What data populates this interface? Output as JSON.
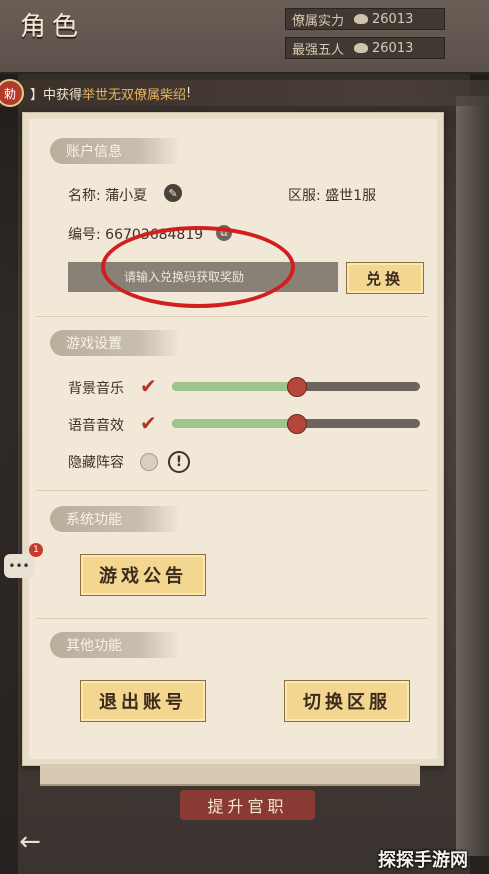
{
  "header": {
    "title": "角色",
    "stats": [
      {
        "label": "僚属实力",
        "icon": "lotus-icon",
        "value": "26013"
      },
      {
        "label": "最强五人",
        "icon": "lotus-icon",
        "value": "26013"
      }
    ]
  },
  "notice": {
    "prefix": "】中获得",
    "highlight": "举世无双僚属柴绍",
    "suffix": "!"
  },
  "account": {
    "section_title": "账户信息",
    "name_label": "名称: 蒲小夏",
    "server_label": "区服: 盛世1服",
    "id_label": "编号: 6670",
    "id_suffix": "3684819",
    "redeem_placeholder": "请输入兑换码获取奖励",
    "redeem_button": "兑换"
  },
  "game_settings": {
    "section_title": "游戏设置",
    "bgm_label": "背景音乐",
    "bgm_checked": true,
    "bgm_level": 0.5,
    "sfx_label": "语音音效",
    "sfx_checked": true,
    "sfx_level": 0.5,
    "hide_lineup_label": "隐藏阵容",
    "hide_lineup_checked": false
  },
  "system": {
    "section_title": "系统功能",
    "announcement_button": "游戏公告"
  },
  "other": {
    "section_title": "其他功能",
    "logout_button": "退出账号",
    "switch_server_button": "切换区服"
  },
  "bottom": {
    "promote_button": "提升官职",
    "chat_badge": "1"
  },
  "watermark": "探探手游网",
  "colors": {
    "accent_red": "#b3332a",
    "button_gold": "#f3d690",
    "slider_green": "#9fc58a",
    "annotation_circle": "#d11f1f"
  }
}
